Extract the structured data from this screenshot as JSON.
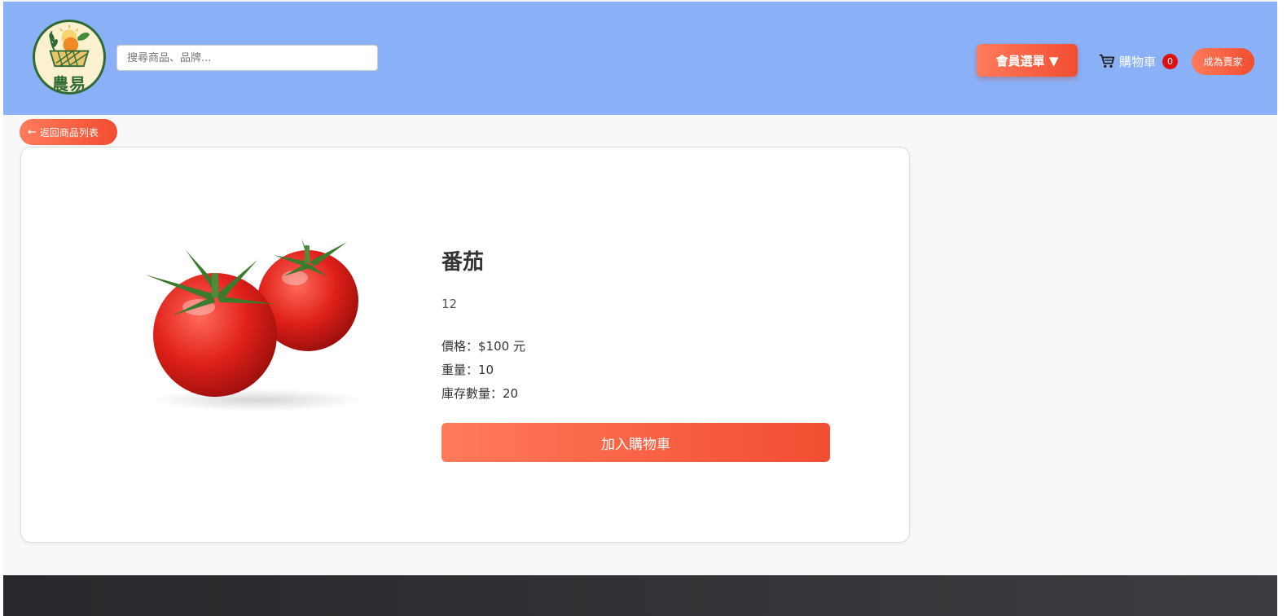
{
  "header": {
    "logo_text": "農易",
    "search_placeholder": "搜尋商品、品牌...",
    "member_menu_label": "會員選單 ▼",
    "cart_label": "購物車",
    "cart_count": "0",
    "become_seller_label": "成為賣家"
  },
  "back_label": "返回商品列表",
  "product": {
    "image_icon": "tomato-image",
    "name": "番茄",
    "description": "12",
    "price": "價格：$100 元",
    "weight": "重量：10",
    "stock": "庫存數量：20",
    "add_to_cart_label": "加入購物車"
  },
  "colors": {
    "header_bg": "#8ab0f7",
    "accent_gradient_start": "#ff7b5a",
    "accent_gradient_end": "#f24d31",
    "cart_badge": "#e01010",
    "footer_bg": "#2b2c2f"
  }
}
